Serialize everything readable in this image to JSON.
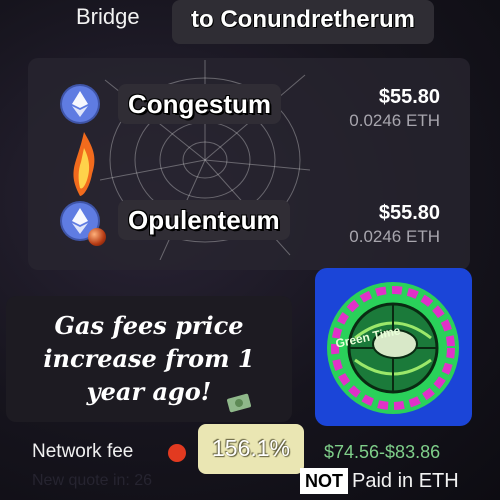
{
  "header": {
    "bridge_label": "Bridge",
    "destination_label": "to Conundretherum"
  },
  "routes": [
    {
      "name": "Congestum",
      "usd": "$55.80",
      "eth": "0.0246 ETH"
    },
    {
      "name": "Opulenteum",
      "usd": "$55.80",
      "eth": "0.0246 ETH"
    }
  ],
  "note": {
    "text": "Gas fees price increase from 1 year ago!"
  },
  "logo": {
    "text": "Green Time"
  },
  "fee": {
    "label": "Network fee",
    "increase_pct": "156.1%",
    "range": "$74.56-$83.86",
    "quote": "New quote in: 26",
    "not_label": "NOT",
    "paid_label": "Paid in ETH"
  },
  "colors": {
    "eth_blue": "#627eea",
    "fee_range_green": "#7fcf8a",
    "pct_bg": "#eae6b3"
  }
}
